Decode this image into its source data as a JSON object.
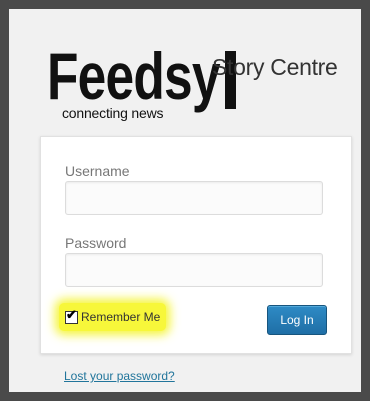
{
  "logo": {
    "wordmark": "Feedsy",
    "tagline": "connecting news",
    "subtitle": "Story Centre"
  },
  "form": {
    "username_label": "Username",
    "username_value": "",
    "password_label": "Password",
    "password_value": "",
    "remember_label": "Remember Me",
    "remember_checked": true,
    "login_button": "Log In"
  },
  "links": {
    "lost_password": "Lost your password?"
  },
  "colors": {
    "page_background": "#f1f1f1",
    "frame": "#4a4a4a",
    "button": "#2a81bb",
    "link": "#21759b",
    "highlight": "#f7f73a"
  }
}
